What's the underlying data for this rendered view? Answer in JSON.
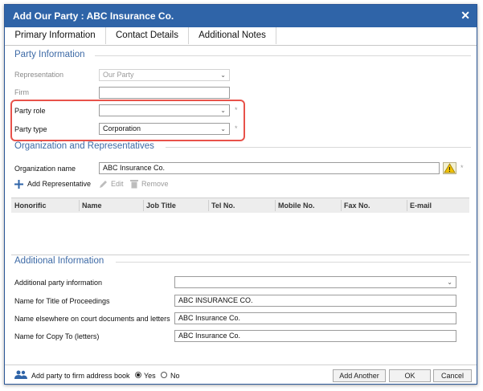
{
  "window": {
    "title": "Add Our Party : ABC Insurance Co.",
    "close_glyph": "✕"
  },
  "tabs": [
    {
      "label": "Primary Information"
    },
    {
      "label": "Contact Details"
    },
    {
      "label": "Additional Notes"
    }
  ],
  "party_info": {
    "heading": "Party Information",
    "representation": {
      "label": "Representation",
      "value": "Our Party"
    },
    "firm": {
      "label": "Firm",
      "value": ""
    },
    "party_role": {
      "label": "Party role",
      "value": ""
    },
    "party_type": {
      "label": "Party type",
      "value": "Corporation"
    },
    "required_mark": "*"
  },
  "org": {
    "heading": "Organization and Representatives",
    "org_name": {
      "label": "Organization name",
      "value": "ABC Insurance Co."
    },
    "warning_glyph": "!",
    "toolbar": {
      "add": "Add Representative",
      "edit": "Edit",
      "remove": "Remove"
    },
    "columns": [
      "Honorific",
      "Name",
      "Job Title",
      "Tel No.",
      "Mobile No.",
      "Fax No.",
      "E-mail"
    ]
  },
  "additional": {
    "heading": "Additional Information",
    "party_info": {
      "label": "Additional party information",
      "value": ""
    },
    "title_of_proceedings": {
      "label": "Name for Title of Proceedings",
      "value": "ABC INSURANCE CO."
    },
    "court_docs": {
      "label": "Name elsewhere on court documents and letters",
      "value": "ABC Insurance Co."
    },
    "copy_to": {
      "label": "Name for Copy To (letters)",
      "value": "ABC Insurance Co."
    }
  },
  "footer": {
    "address_book_label": "Add party to firm address book",
    "yes_label": "Yes",
    "no_label": "No",
    "selected": "Yes",
    "add_another": "Add Another",
    "ok": "OK",
    "cancel": "Cancel"
  },
  "icons": {
    "people": "people-icon",
    "warning": "warning-icon",
    "plus": "plus-icon",
    "pencil": "pencil-icon",
    "trash": "trash-icon"
  },
  "colors": {
    "titlebar": "#2f64a8",
    "section_heading": "#3d6aa6",
    "highlight": "#e8524a"
  }
}
